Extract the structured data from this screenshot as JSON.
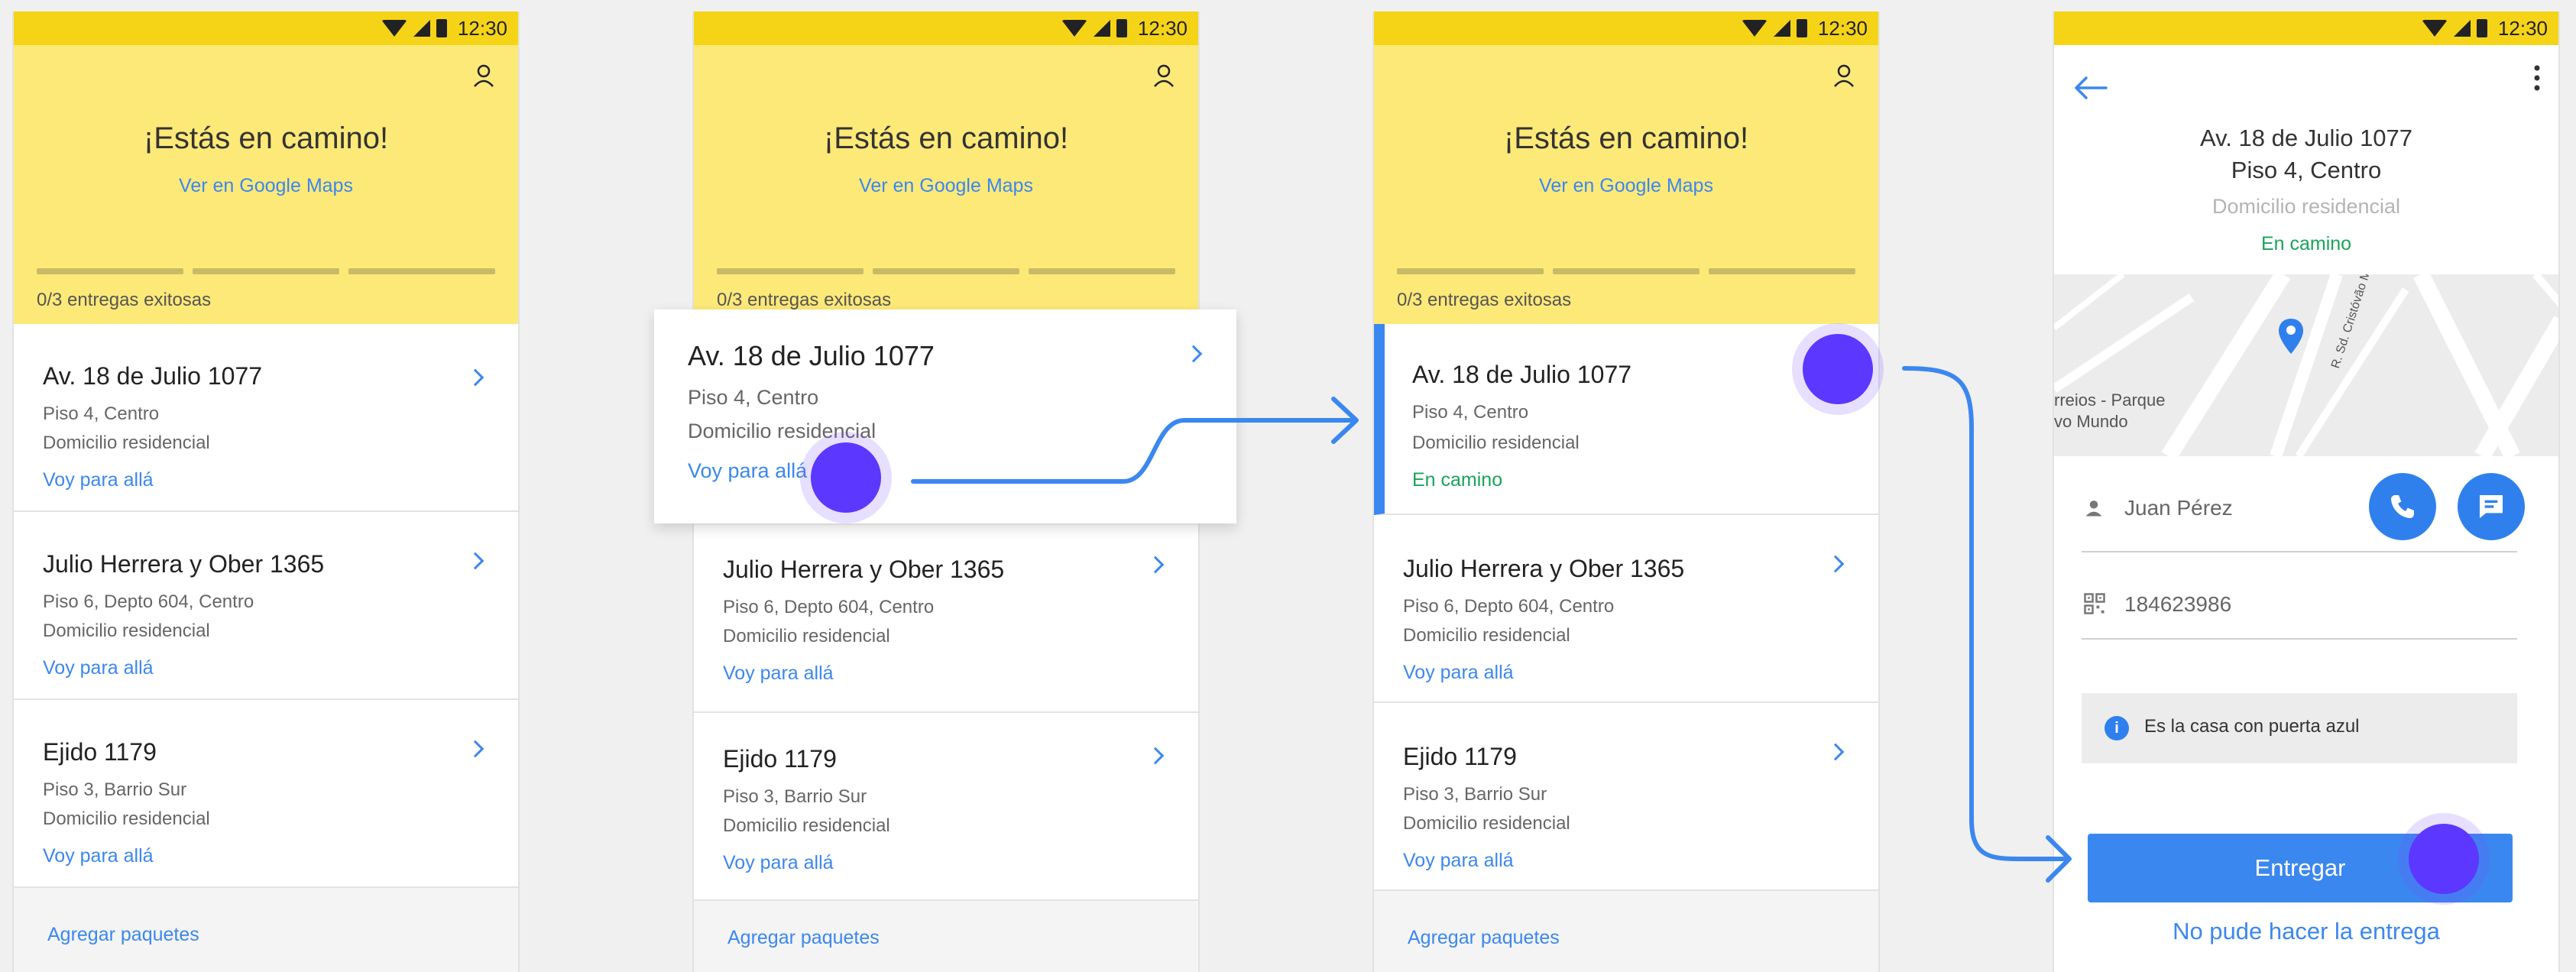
{
  "status": {
    "time": "12:30"
  },
  "colors": {
    "accent_yellow": "#f5d417",
    "hero_yellow": "#fde978",
    "link_blue": "#3b87f0",
    "success_green": "#1aa35a",
    "touch_purple": "#5b37ff"
  },
  "home": {
    "title": "¡Estás en camino!",
    "maps_link": "Ver en Google Maps",
    "progress_total": 3,
    "progress_text": "0/3 entregas exitosas",
    "add_packages": "Agregar paquetes"
  },
  "deliveries": [
    {
      "address": "Av. 18 de Julio 1077",
      "detail": "Piso 4, Centro",
      "type": "Domicilio residencial",
      "action": "Voy para allá",
      "status": "En camino"
    },
    {
      "address": "Julio Herrera y Ober 1365",
      "detail": "Piso 6, Depto 604, Centro",
      "type": "Domicilio residencial",
      "action": "Voy para allá"
    },
    {
      "address": "Ejido 1179",
      "detail": "Piso 3, Barrio Sur",
      "type": "Domicilio residencial",
      "action": "Voy para allá"
    }
  ],
  "detail": {
    "address_line1": "Av. 18 de Julio 1077",
    "address_line2": "Piso 4, Centro",
    "type": "Domicilio residencial",
    "status": "En camino",
    "map_labels": {
      "street": "R. Sd. Cristóvão Morais",
      "place_1": "rreios - Parque",
      "place_2": "vo Mundo"
    },
    "recipient": "Juan Pérez",
    "code": "184623986",
    "note": "Es la casa con puerta azul",
    "primary_action": "Entregar",
    "secondary_action": "No pude hacer la entrega"
  },
  "icons": [
    "wifi-icon",
    "cell-signal-icon",
    "battery-icon",
    "profile-icon",
    "chevron-right-icon",
    "back-arrow-icon",
    "more-vert-icon",
    "location-pin-icon",
    "person-icon",
    "qr-code-icon",
    "phone-icon",
    "chat-icon",
    "info-icon"
  ]
}
